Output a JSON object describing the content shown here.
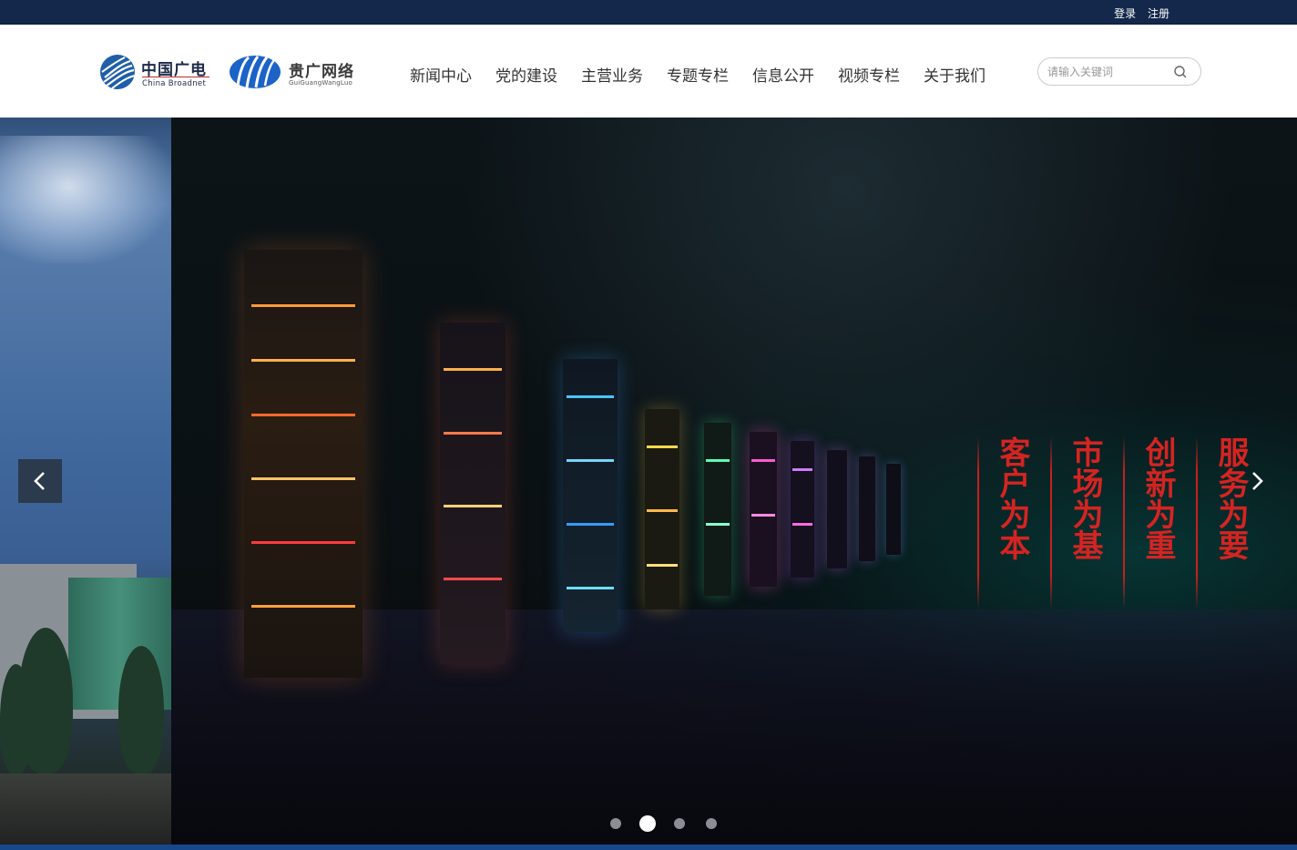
{
  "topbar": {
    "login": "登录",
    "register": "注册"
  },
  "logos": {
    "primary": {
      "name_cn": "中国广电",
      "name_en": "China Broadnet",
      "icon": "china-broadnet-logo"
    },
    "secondary": {
      "name_cn": "贵广网络",
      "name_en": "GuiGuangWangLuo",
      "icon": "guiguang-logo"
    }
  },
  "nav": {
    "items": [
      {
        "label": "新闻中心"
      },
      {
        "label": "党的建设"
      },
      {
        "label": "主营业务"
      },
      {
        "label": "专题专栏"
      },
      {
        "label": "信息公开"
      },
      {
        "label": "视频专栏"
      },
      {
        "label": "关于我们"
      }
    ]
  },
  "search": {
    "placeholder": "请输入关键词",
    "value": "",
    "icon": "search-icon"
  },
  "banner": {
    "slogans": [
      "客户为本",
      "市场为基",
      "创新为重",
      "服务为要"
    ],
    "prev_icon": "chevron-left-icon",
    "next_icon": "chevron-right-icon",
    "slide_count": 4,
    "active_slide": 2
  },
  "colors": {
    "topbar": "#13284a",
    "slogan_red": "#d42422",
    "bottom_strip": "#17488c"
  }
}
